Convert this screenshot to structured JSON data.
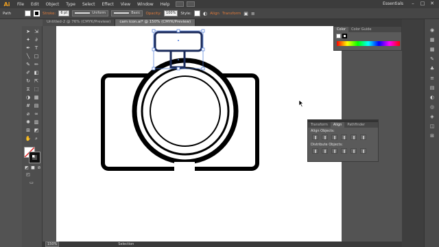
{
  "app": {
    "logo": "Ai"
  },
  "menu": {
    "items": [
      "File",
      "Edit",
      "Object",
      "Type",
      "Select",
      "Effect",
      "View",
      "Window",
      "Help"
    ]
  },
  "workspace": "Essentials",
  "control_bar": {
    "selection_type": "Path",
    "stroke_label": "Stroke:",
    "stroke_weight": "6 pt",
    "profile": "Uniform",
    "brush": "Basic",
    "opacity_label": "Opacity:",
    "opacity_value": "100%",
    "style_label": "Style:",
    "align_link": "Align",
    "transform_link": "Transform"
  },
  "document_tabs": [
    {
      "label": "Untitled-2 @ 76% (CMYK/Preview)",
      "active": false
    },
    {
      "label": "cam icon.ai* @ 150% (CMYK/Preview)",
      "active": true
    }
  ],
  "color_panel": {
    "tabs": [
      "Color",
      "Color Guide"
    ]
  },
  "align_panel": {
    "tabs": [
      "Transform",
      "Align",
      "Pathfinder"
    ],
    "align_objects_label": "Align Objects:",
    "distribute_objects_label": "Distribute Objects:"
  },
  "status_bar": {
    "zoom": "150%",
    "tool": "Selection"
  },
  "colors": {
    "accent": "#e07a3a",
    "selection_blue": "#4a78d8"
  }
}
